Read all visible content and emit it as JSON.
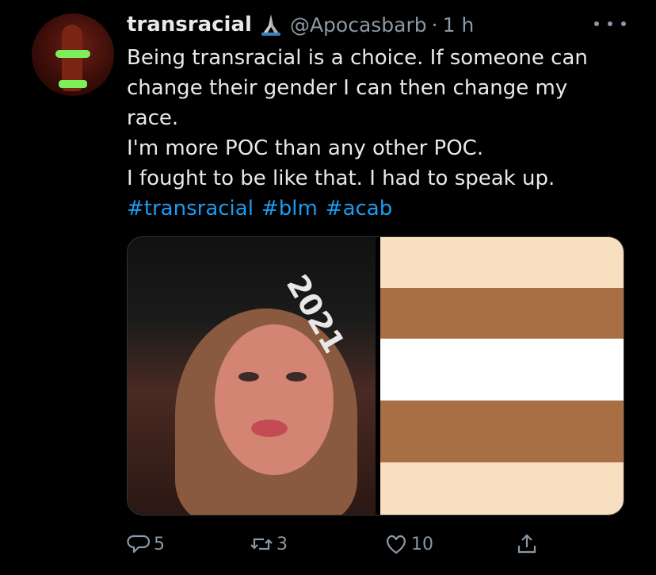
{
  "tweet": {
    "display_name": "transracial",
    "name_emoji": "praying-hands-emoji",
    "handle": "@Apocasbarb",
    "separator": "·",
    "time": "1 h",
    "more_icon": "more-icon",
    "text_lines": [
      "Being transracial is a choice. If someone can",
      "change their gender I can then change my",
      "race.",
      "I'm more POC than any other POC.",
      "I fought to be like that. I had to speak up."
    ],
    "hashtags": [
      "#transracial",
      "#blm",
      "#acab"
    ],
    "hashtag_color": "#1d9bf0",
    "media": {
      "photo_caption_text": "2021",
      "flag_colors": [
        "#f9dfc1",
        "#a86f45",
        "#ffffff",
        "#a86f45",
        "#f9dfc1"
      ]
    },
    "actions": {
      "reply": {
        "icon": "reply-icon",
        "count": "5"
      },
      "retweet": {
        "icon": "retweet-icon",
        "count": "3"
      },
      "like": {
        "icon": "heart-icon",
        "count": "10"
      },
      "share": {
        "icon": "share-icon",
        "count": ""
      }
    }
  }
}
